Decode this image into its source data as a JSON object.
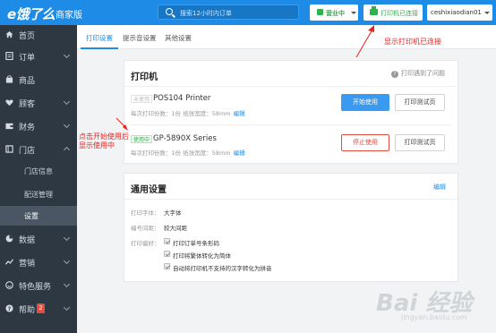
{
  "header": {
    "logo": "e饿了么",
    "edition": "商家版",
    "search_placeholder": "搜索12小时内订单",
    "status_label": "营业中",
    "printer_label": "打印机已连接",
    "username": "ceshixiaodian01"
  },
  "sidebar": {
    "items": [
      {
        "label": "首页",
        "icon": "home-icon"
      },
      {
        "label": "订单",
        "icon": "list-icon"
      },
      {
        "label": "商品",
        "icon": "bag-icon"
      },
      {
        "label": "顾客",
        "icon": "heart-icon"
      },
      {
        "label": "财务",
        "icon": "wallet-icon"
      },
      {
        "label": "门店",
        "icon": "store-icon"
      },
      {
        "label": "数据",
        "icon": "pie-chart-icon"
      },
      {
        "label": "营销",
        "icon": "chart-line-icon"
      },
      {
        "label": "特色服务",
        "icon": "smile-icon"
      },
      {
        "label": "帮助",
        "icon": "help-icon",
        "badge": "2"
      }
    ],
    "store_subitems": [
      "门店信息",
      "配送管理",
      "设置"
    ]
  },
  "tabs": [
    "打印设置",
    "提示音设置",
    "其他设置"
  ],
  "printer_card": {
    "title": "打印机",
    "help_text": "打印遇到了问题",
    "printers": [
      {
        "status_tag": "未使用",
        "name": "POS104 Printer",
        "meta": "每次打印份数：1份  纸张宽度：58mm",
        "edit": "编辑",
        "primary_action": "开始使用",
        "test_action": "打印测试页"
      },
      {
        "status_tag": "使用中",
        "name": "GP-5890X Series",
        "meta": "每次打印份数：1份  纸张宽度：58mm",
        "edit": "编辑",
        "primary_action": "停止使用",
        "test_action": "打印测试页"
      }
    ]
  },
  "general_card": {
    "title": "通用设置",
    "edit": "编辑",
    "rows": [
      {
        "label": "打印字体：",
        "value": "大字体"
      },
      {
        "label": "编号间距：",
        "value": "较大间距"
      },
      {
        "label": "打印偏好：",
        "value": "打印订单号条形码"
      }
    ],
    "checkboxes": [
      "打印订单号条形码",
      "打印将繁体转化为简体",
      "自动将打印机不支持的汉字转化为拼音"
    ]
  },
  "annotations": {
    "top": "显示打印机已连接",
    "left_line1": "点击开始使用后",
    "left_line2": "显示使用中",
    "color": "#e8231f"
  },
  "watermark": {
    "text": "Bai 经验",
    "sub": "jingyan.baidu.com"
  }
}
